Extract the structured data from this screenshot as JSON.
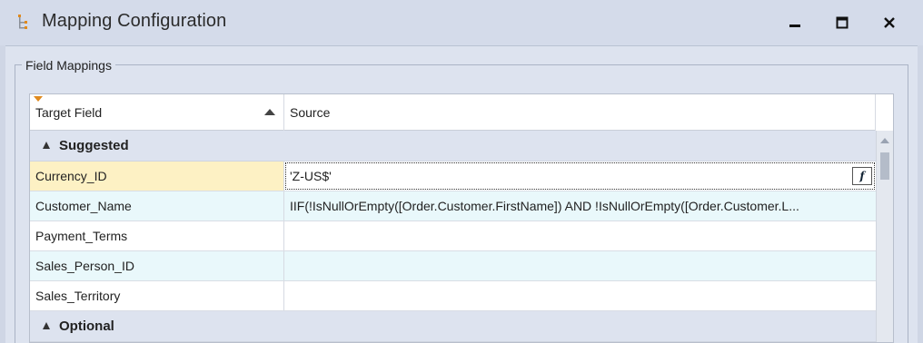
{
  "window": {
    "title": "Mapping Configuration",
    "icon": "tree-icon"
  },
  "groupbox": {
    "title": "Field Mappings"
  },
  "grid": {
    "columns": [
      "Target Field",
      "Source"
    ],
    "groups": [
      {
        "label": "Suggested",
        "rows": [
          {
            "target": "Currency_ID",
            "source": "'Z-US$'"
          },
          {
            "target": "Customer_Name",
            "source": "IIF(!IsNullOrEmpty([Order.Customer.FirstName]) AND !IsNullOrEmpty([Order.Customer.L..."
          },
          {
            "target": "Payment_Terms",
            "source": ""
          },
          {
            "target": "Sales_Person_ID",
            "source": ""
          },
          {
            "target": "Sales_Territory",
            "source": ""
          }
        ]
      },
      {
        "label": "Optional",
        "rows": []
      }
    ],
    "function_button_label": "f"
  },
  "colors": {
    "selected_target": "#fdf1c4",
    "alt_row": "#e9f8fb",
    "group_row": "#dde3ef"
  }
}
